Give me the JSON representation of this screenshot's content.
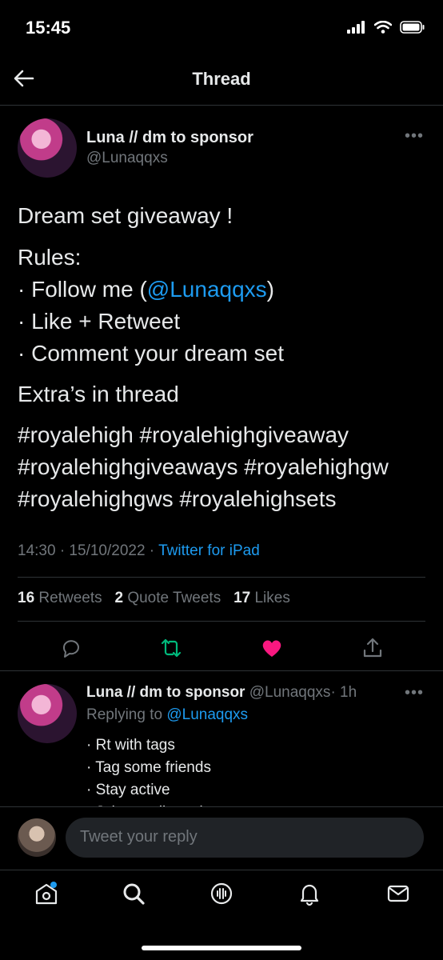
{
  "status_bar": {
    "time": "15:45"
  },
  "header": {
    "title": "Thread"
  },
  "tweet": {
    "author_name": "Luna // dm to sponsor",
    "author_handle": "@Lunaqqxs",
    "line1": "Dream set giveaway !",
    "rules_label": "Rules:",
    "rule1_prefix": "· Follow me (",
    "rule1_mention": "@Lunaqqxs",
    "rule1_suffix": ")",
    "rule2": "· Like + Retweet",
    "rule3": "· Comment your dream set",
    "extras": "Extra’s in thread",
    "hashtags_line1": "#royalehigh #royalehighgiveaway",
    "hashtags_line2": "#royalehighgiveaways #royalehighgw",
    "hashtags_line3": "#royalehighgws #royalehighsets",
    "timestamp": "14:30 · 15/10/2022 · ",
    "source": "Twitter for iPad",
    "retweets_count": "16",
    "retweets_label": "Retweets",
    "quotes_count": "2",
    "quotes_label": "Quote Tweets",
    "likes_count": "17",
    "likes_label": "Likes"
  },
  "reply": {
    "author_name": "Luna // dm to sponsor",
    "author_handle": "@Lunaqqxs",
    "time": "· 1h",
    "replying_to_label": "Replying to ",
    "replying_to_handle": "@Lunaqqxs",
    "line1": "· Rt with tags",
    "line2": "· Tag some friends",
    "line3": "· Stay active",
    "line4": "· Join our discord"
  },
  "compose": {
    "placeholder": "Tweet your reply"
  },
  "colors": {
    "accent": "#1d9bf0",
    "retweet": "#00ba7c",
    "like": "#f91880",
    "background": "#000000"
  },
  "icons": [
    "back-arrow-icon",
    "more-icon",
    "reply-icon",
    "retweet-icon",
    "like-icon",
    "share-icon",
    "home-icon",
    "search-icon",
    "spaces-icon",
    "notifications-icon",
    "messages-icon"
  ]
}
